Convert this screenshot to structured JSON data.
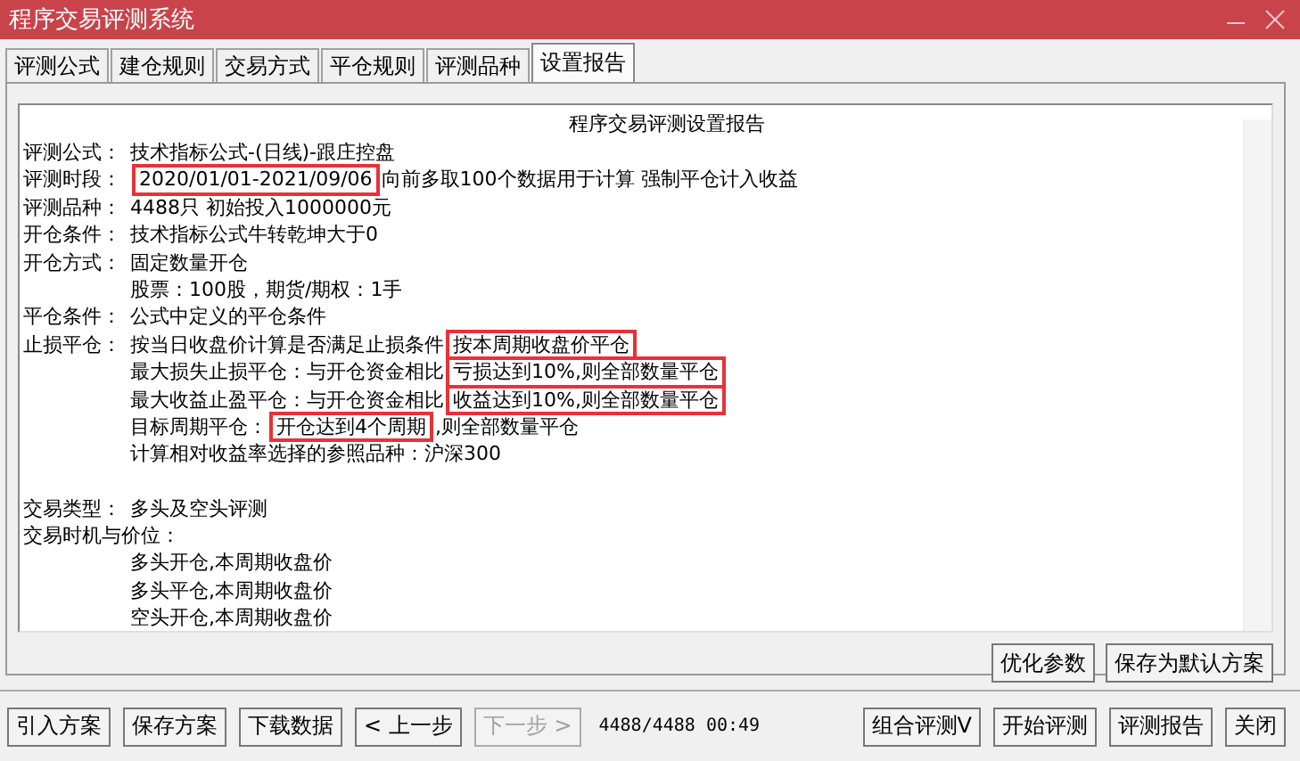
{
  "window": {
    "title": "程序交易评测系统"
  },
  "tabs": [
    {
      "label": "评测公式",
      "selected": false
    },
    {
      "label": "建仓规则",
      "selected": false
    },
    {
      "label": "交易方式",
      "selected": false
    },
    {
      "label": "平仓规则",
      "selected": false
    },
    {
      "label": "评测品种",
      "selected": false
    },
    {
      "label": "设置报告",
      "selected": true
    }
  ],
  "report": {
    "title": "程序交易评测设置报告",
    "sections": [
      [
        {
          "label": "评测公式：",
          "segments": [
            {
              "text": "技术指标公式-(日线)-跟庄控盘",
              "boxed": false
            }
          ]
        },
        {
          "label": "评测时段：",
          "segments": [
            {
              "text": "2020/01/01-2021/09/06",
              "boxed": true
            },
            {
              "text": "向前多取100个数据用于计算 强制平仓计入收益",
              "boxed": false
            }
          ]
        },
        {
          "label": "评测品种：",
          "segments": [
            {
              "text": "4488只 初始投入1000000元",
              "boxed": false
            }
          ]
        },
        {
          "label": "开仓条件：",
          "segments": [
            {
              "text": "技术指标公式牛转乾坤大于0",
              "boxed": false
            }
          ]
        },
        {
          "label": "开仓方式：",
          "segments": [
            {
              "text": "固定数量开仓",
              "boxed": false
            }
          ]
        },
        {
          "segments": [
            {
              "text": "股票：100股，期货/期权：1手",
              "boxed": false
            }
          ]
        },
        {
          "label": "平仓条件：",
          "segments": [
            {
              "text": "公式中定义的平仓条件",
              "boxed": false
            }
          ]
        },
        {
          "label": "止损平仓：",
          "segments": [
            {
              "text": "按当日收盘价计算是否满足止损条件",
              "boxed": false
            },
            {
              "text": "按本周期收盘价平仓",
              "boxed": true
            }
          ]
        },
        {
          "segments": [
            {
              "text": "最大损失止损平仓：与开仓资金相比",
              "boxed": false
            },
            {
              "text": "亏损达到10%,则全部数量平仓",
              "boxed": true
            }
          ]
        },
        {
          "segments": [
            {
              "text": "最大收益止盈平仓：与开仓资金相比",
              "boxed": false
            },
            {
              "text": "收益达到10%,则全部数量平仓",
              "boxed": true
            }
          ]
        },
        {
          "segments": [
            {
              "text": "目标周期平仓：",
              "boxed": false
            },
            {
              "text": "开仓达到4个周期",
              "boxed": true
            },
            {
              "text": ",则全部数量平仓",
              "boxed": false
            }
          ]
        },
        {
          "segments": [
            {
              "text": "计算相对收益率选择的参照品种：沪深300",
              "boxed": false
            }
          ]
        }
      ],
      [
        {
          "label": "交易类型：",
          "segments": [
            {
              "text": "多头及空头评测",
              "boxed": false
            }
          ]
        },
        {
          "label": "交易时机与价位："
        },
        {
          "segments": [
            {
              "text": "多头开仓,本周期收盘价",
              "boxed": false
            }
          ]
        },
        {
          "segments": [
            {
              "text": "多头平仓,本周期收盘价",
              "boxed": false
            }
          ]
        },
        {
          "segments": [
            {
              "text": "空头开仓,本周期收盘价",
              "boxed": false
            }
          ]
        }
      ]
    ]
  },
  "panel_buttons": [
    "优化参数",
    "保存为默认方案"
  ],
  "bottom_buttons": [
    {
      "label": "引入方案",
      "disabled": false
    },
    {
      "label": "保存方案",
      "disabled": false
    },
    {
      "label": "下载数据",
      "disabled": false
    },
    {
      "label": "< 上一步",
      "disabled": false
    },
    {
      "label": "下一步 >",
      "disabled": true
    }
  ],
  "status": "4488/4488 00:49",
  "right_buttons": [
    "组合评测V",
    "开始评测",
    "评测报告",
    "关闭"
  ]
}
